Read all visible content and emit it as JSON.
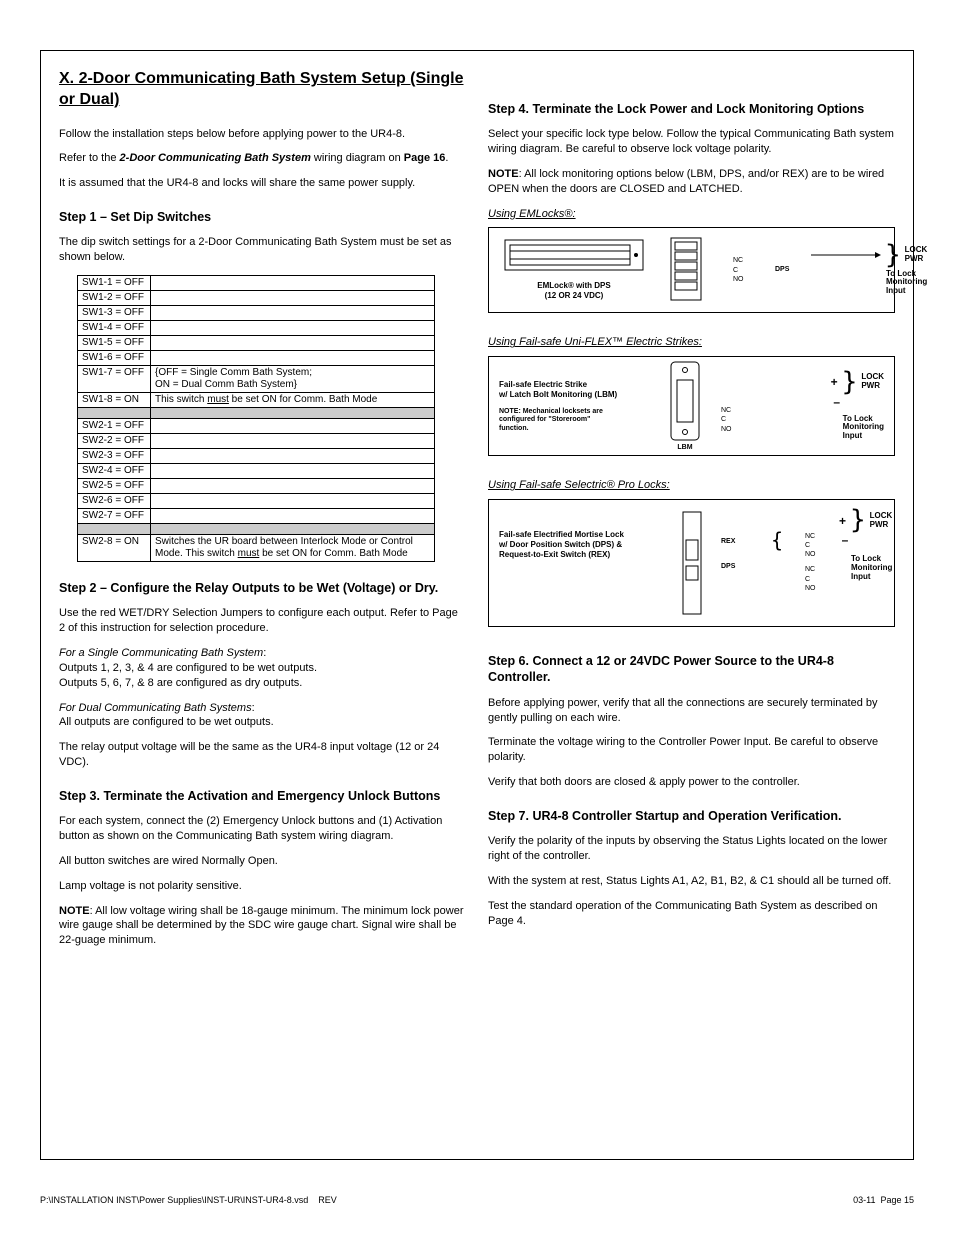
{
  "title": "X.  2-Door Communicating Bath System Setup (Single or Dual)",
  "intro1": "Follow the installation steps below before applying power to the UR4-8.",
  "intro2_pre": "Refer to the ",
  "intro2_em": "2-Door Communicating Bath System",
  "intro2_mid": " wiring diagram on ",
  "intro2_page": "Page 16",
  "intro2_end": ".",
  "intro3": "It is assumed that the UR4-8 and locks will share the same power supply.",
  "step1_title": "Step 1 – Set Dip Switches",
  "step1_p": "The dip switch settings for a 2-Door Communicating Bath System must be set as shown below.",
  "dip": {
    "r1": "SW1-1 = OFF",
    "r2": "SW1-2 = OFF",
    "r3": "SW1-3 = OFF",
    "r4": "SW1-4 = OFF",
    "r5": "SW1-5 = OFF",
    "r6": "SW1-6 = OFF",
    "r7a": "SW1-7 = OFF",
    "r7b": "{OFF = Single Comm Bath System;\nON = Dual Comm Bath System}",
    "r8a": "SW1-8 = ON",
    "r8b_pre": "This switch ",
    "r8b_u": "must",
    "r8b_post": " be set ON for Comm. Bath Mode",
    "r9": "SW2-1 = OFF",
    "r10": "SW2-2 = OFF",
    "r11": "SW2-3 = OFF",
    "r12": "SW2-4 = OFF",
    "r13": "SW2-5 = OFF",
    "r14": "SW2-6 = OFF",
    "r15": "SW2-7 = OFF",
    "r16a": "SW2-8 = ON",
    "r16b_pre": "Switches the UR board between Interlock Mode or Control Mode.  This switch ",
    "r16b_u": "must",
    "r16b_post": " be set ON for Comm. Bath Mode"
  },
  "step2_title": "Step 2 – Configure the Relay Outputs to be Wet (Voltage) or Dry.",
  "step2_p1": "Use the red WET/DRY Selection Jumpers to configure each output.  Refer to Page 2 of this instruction for selection procedure.",
  "step2_p2a": "For a Single Communicating Bath System",
  "step2_p2b": "Outputs 1, 2, 3, & 4 are configured to be wet outputs.",
  "step2_p2c": "Outputs 5, 6, 7, & 8 are configured as dry outputs.",
  "step2_p3a": "For Dual Communicating Bath Systems",
  "step2_p3b": "All outputs are configured to be wet outputs.",
  "step2_p4": "The relay output voltage will be the same as the UR4-8 input voltage (12 or 24 VDC).",
  "step3_title": "Step 3.  Terminate the Activation and Emergency Unlock Buttons",
  "step3_p1": "For each system, connect the (2) Emergency Unlock buttons and (1) Activation button as shown on the Communicating Bath system wiring diagram.",
  "step3_p2": "All button switches are wired Normally Open.",
  "step3_p3": "Lamp voltage is not polarity sensitive.",
  "step3_p4_pre": "NOTE",
  "step3_p4": ":  All low voltage wiring shall be 18-gauge minimum.  The minimum lock power wire gauge shall be determined by the SDC wire gauge chart.  Signal wire shall be 22-guage minimum.",
  "step4_title": "Step 4.  Terminate the Lock Power and Lock Monitoring Options",
  "step4_p1": "Select your specific lock type below.  Follow the typical Communicating Bath system wiring diagram.  Be careful to observe lock voltage polarity.",
  "step4_p2_pre": "NOTE",
  "step4_p2": ":  All lock monitoring options below (LBM, DPS, and/or REX) are to be wired OPEN when the doors are CLOSED and LATCHED.",
  "using_emlocks": "Using EMLocks®:",
  "diag1": {
    "label1": "EMLock® with DPS",
    "label2": "(12 OR 24 VDC)",
    "nc": "NC",
    "c": "C",
    "no": "NO",
    "dps": "DPS",
    "lockpwr1": "LOCK",
    "lockpwr2": "PWR",
    "tolock1": "To Lock",
    "tolock2": "Monitoring",
    "tolock3": "Input"
  },
  "using_uniflex": "Using Fail-safe Uni-FLEX™  Electric Strikes:",
  "diag2": {
    "label1": "Fail-safe Electric Strike",
    "label2": "w/ Latch Bolt Monitoring (LBM)",
    "note1": "NOTE:  Mechanical locksets are",
    "note2": "configured for \"Storeroom\"",
    "note3": "function.",
    "nc": "NC",
    "c": "C",
    "no": "NO",
    "lbm": "LBM",
    "plus": "+",
    "minus": "–",
    "lockpwr1": "LOCK",
    "lockpwr2": "PWR",
    "tolock1": "To Lock",
    "tolock2": "Monitoring",
    "tolock3": "Input"
  },
  "using_selectric": "Using Fail-safe Selectric® Pro Locks:",
  "diag3": {
    "label1": "Fail-safe Electrified Mortise Lock",
    "label2": "w/ Door Position Switch (DPS) &",
    "label3": "Request-to-Exit Switch (REX)",
    "rex": "REX",
    "dps": "DPS",
    "nc": "NC",
    "c": "C",
    "no": "NO",
    "plus": "+",
    "minus": "–",
    "lockpwr1": "LOCK",
    "lockpwr2": "PWR",
    "tolock1": "To Lock",
    "tolock2": "Monitoring",
    "tolock3": "Input"
  },
  "step6_title": "Step 6.  Connect a 12 or 24VDC Power Source to the UR4-8 Controller.",
  "step6_p1": "Before applying power, verify that all the connections are securely terminated by gently pulling on each wire.",
  "step6_p2": "Terminate the voltage wiring to the Controller Power Input.  Be careful to observe polarity.",
  "step6_p3": "Verify that both doors are closed & apply power to the controller.",
  "step7_title": "Step 7.  UR4-8 Controller Startup and Operation Verification.",
  "step7_p1": "Verify the polarity of the inputs by observing the Status Lights located on the lower right of the controller.",
  "step7_p2": "With the system at rest, Status Lights A1, A2, B1, B2, & C1 should all be turned off.",
  "step7_p3": "Test the standard operation of the Communicating Bath System as described on Page 4.",
  "footer": {
    "path": "P:\\INSTALLATION INST\\Power Supplies\\INST-UR\\INST-UR4-8.vsd",
    "rev": "REV",
    "date": "03-11",
    "page": "Page 15"
  }
}
